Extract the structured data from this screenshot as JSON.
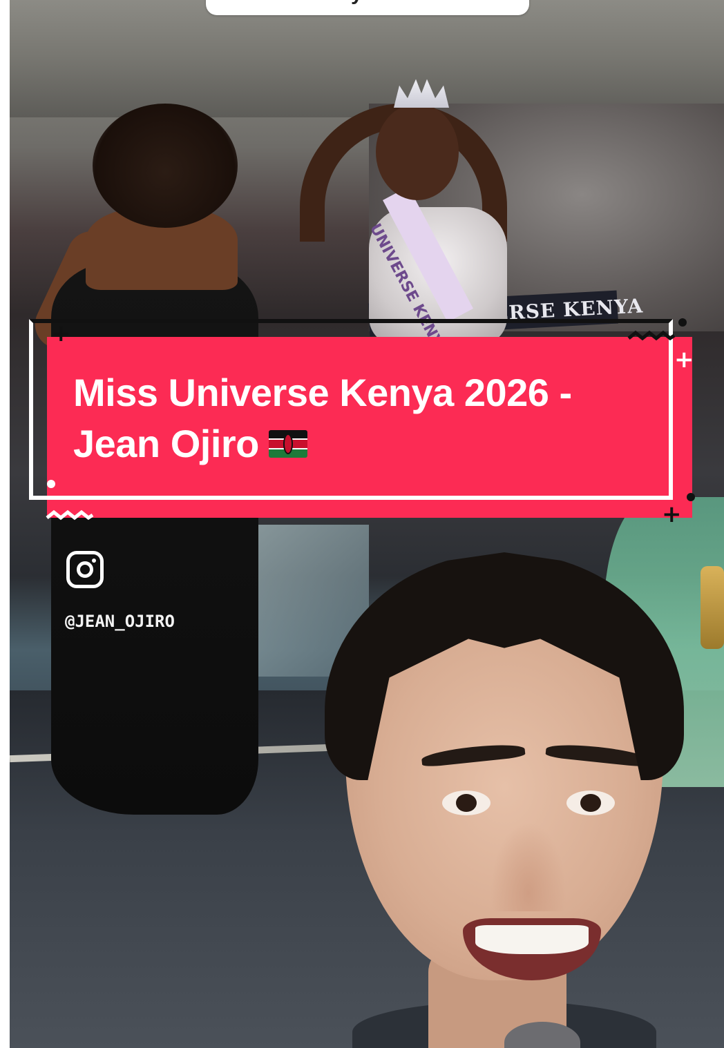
{
  "top_pill": {
    "text": "y"
  },
  "caption": {
    "line1": "Miss Universe Kenya 2026 -",
    "line2": "Jean Ojiro",
    "flag": "kenya-flag",
    "background_color": "#fc2b54"
  },
  "watermark": {
    "icon": "instagram-icon",
    "handle": "@JEAN_OJIRO"
  },
  "scene": {
    "banner_text": "ERSE KENYA",
    "sash_text": "UNIVERSE KENYA"
  },
  "colors": {
    "accent": "#fc2b54",
    "outline_dark": "#111111",
    "outline_light": "#ffffff"
  }
}
